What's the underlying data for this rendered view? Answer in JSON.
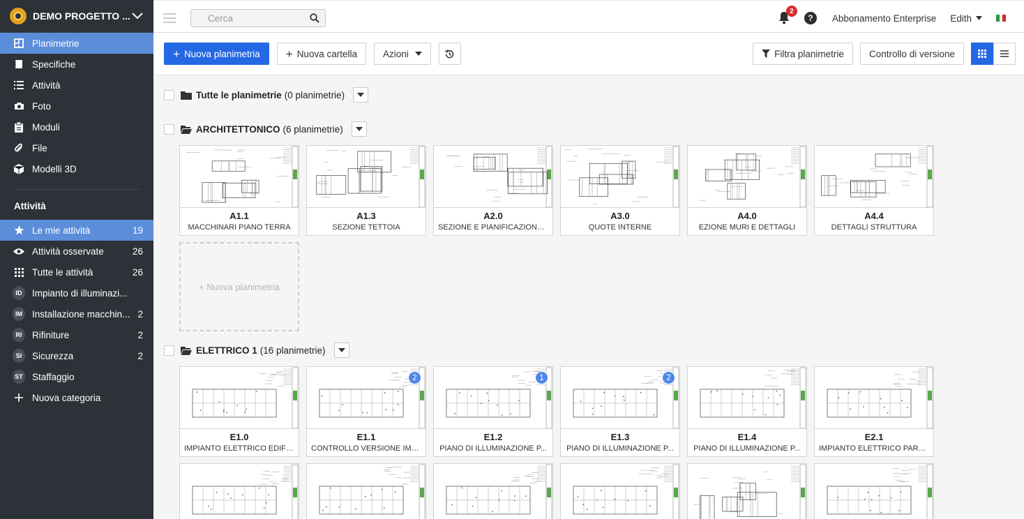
{
  "project": {
    "name": "DEMO PROGETTO ...",
    "logo_color": "#e6a21d"
  },
  "nav": [
    {
      "label": "Planimetrie",
      "icon": "floorplan-icon",
      "active": true
    },
    {
      "label": "Specifiche",
      "icon": "notebook-icon"
    },
    {
      "label": "Attività",
      "icon": "list-icon"
    },
    {
      "label": "Foto",
      "icon": "camera-icon"
    },
    {
      "label": "Moduli",
      "icon": "clipboard-icon"
    },
    {
      "label": "File",
      "icon": "paperclip-icon"
    },
    {
      "label": "Modelli 3D",
      "icon": "cube-icon"
    }
  ],
  "tasks_section": {
    "title": "Attività",
    "items": [
      {
        "label": "Le mie attività",
        "count": "19",
        "icon": "star-icon",
        "active": true
      },
      {
        "label": "Attività osservate",
        "count": "26",
        "icon": "eye-icon"
      },
      {
        "label": "Tutte le attività",
        "count": "26",
        "icon": "grid-dots-icon"
      },
      {
        "label": "Impianto di illuminazi...",
        "count": "",
        "avatar": "ID"
      },
      {
        "label": "Installazione macchin...",
        "count": "2",
        "avatar": "IM"
      },
      {
        "label": "Rifiniture",
        "count": "2",
        "avatar": "RI"
      },
      {
        "label": "Sicurezza",
        "count": "2",
        "avatar": "SI"
      },
      {
        "label": "Staffaggio",
        "count": "",
        "avatar": "ST"
      },
      {
        "label": "Nuova categoria",
        "count": "",
        "icon": "plus-icon"
      }
    ]
  },
  "topbar": {
    "search_placeholder": "Cerca",
    "notifications": "2",
    "help": "?",
    "subscription": "Abbonamento Enterprise",
    "user": "Edith"
  },
  "toolbar": {
    "new_plan": "Nuova planimetria",
    "new_folder": "Nuova cartella",
    "actions": "Azioni",
    "filter": "Filtra planimetrie",
    "version_control": "Controllo di versione"
  },
  "groups": [
    {
      "name": "Tutte le planimetrie",
      "count": "(0 planimetrie)",
      "open": false
    },
    {
      "name": "ARCHITETTONICO",
      "count": "(6 planimetrie)",
      "open": true,
      "sheets": [
        {
          "code": "A1.1",
          "title": "MACCHINARI PIANO TERRA"
        },
        {
          "code": "A1.3",
          "title": "SEZIONE TETTOIA"
        },
        {
          "code": "A2.0",
          "title": "SEZIONE E PIANIFICAZIONE..."
        },
        {
          "code": "A3.0",
          "title": "QUOTE INTERNE"
        },
        {
          "code": "A4.0",
          "title": "EZIONE MURI E DETTAGLI"
        },
        {
          "code": "A4.4",
          "title": "DETTAGLI STRUTTURA"
        }
      ],
      "add_label": "+ Nuova planimetria"
    },
    {
      "name": "ELETTRICO 1",
      "count": "(16 planimetrie)",
      "open": true,
      "sheets": [
        {
          "code": "E1.0",
          "title": "IMPIANTO ELETTRICO EDIFI...",
          "badge": ""
        },
        {
          "code": "E1.1",
          "title": "CONTROLLO VERSIONE IMP...",
          "badge": "2"
        },
        {
          "code": "E1.2",
          "title": "PIANO DI ILLUMINAZIONE P...",
          "badge": "1"
        },
        {
          "code": "E1.3",
          "title": "PIANO DI ILLUMINAZIONE P...",
          "badge": "2"
        },
        {
          "code": "E1.4",
          "title": "PIANO DI ILLUMINAZIONE P...",
          "badge": ""
        },
        {
          "code": "E2.1",
          "title": "IMPIANTO ELETTRICO PARZ...",
          "badge": ""
        }
      ]
    }
  ],
  "colors": {
    "sidebar": "#2d3138",
    "active": "#5b8dd9",
    "primary": "#2468e3",
    "badge": "#4f86ea",
    "alert": "#d72b2b"
  }
}
